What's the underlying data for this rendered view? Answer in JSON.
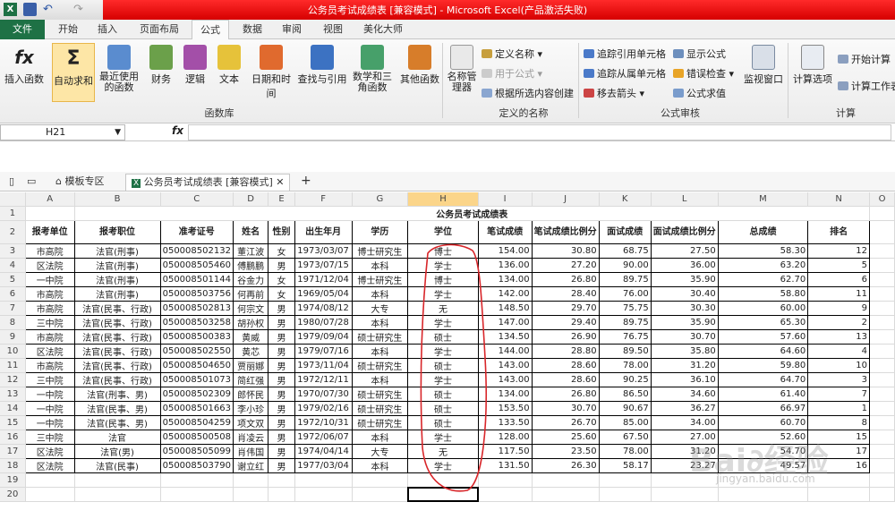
{
  "window_title": "公务员考试成绩表 [兼容模式] - Microsoft Excel(产品激活失败)",
  "quick_access": {
    "excel_icon": "X"
  },
  "tabs": [
    "文件",
    "开始",
    "插入",
    "页面布局",
    "公式",
    "数据",
    "审阅",
    "视图",
    "美化大师"
  ],
  "ribbon": {
    "insert_function": "插入函数",
    "autosum": "自动求和",
    "recent": "最近使用的函数",
    "finance": "财务",
    "logic": "逻辑",
    "text": "文本",
    "datetime": "日期和时间",
    "lookup": "查找与引用",
    "math": "数学和三角函数",
    "other": "其他函数",
    "group_library": "函数库",
    "name_manager": "名称管理器",
    "define_name": "定义名称",
    "use_in_formula": "用于公式",
    "create_from_sel": "根据所选内容创建",
    "group_names": "定义的名称",
    "trace_precedents": "追踪引用单元格",
    "trace_dependents": "追踪从属单元格",
    "remove_arrows": "移去箭头",
    "show_formulas": "显示公式",
    "error_check": "错误检查",
    "evaluate": "公式求值",
    "watch_window": "监视窗口",
    "group_audit": "公式审核",
    "calc_options": "计算选项",
    "calc_now": "开始计算",
    "calc_sheet": "计算工作表",
    "group_calc": "计算"
  },
  "formula_bar": {
    "cell": "H21",
    "fx": "fx"
  },
  "workbook_tabs": {
    "template": "模板专区",
    "file": "公务员考试成绩表 [兼容模式]",
    "add": "+"
  },
  "columns": [
    "A",
    "B",
    "C",
    "D",
    "E",
    "F",
    "G",
    "H",
    "I",
    "J",
    "K",
    "L",
    "M",
    "N",
    "O"
  ],
  "selected_column": "H",
  "sheet_title": "公务员考试成绩表",
  "headers": [
    "报考单位",
    "报考职位",
    "准考证号",
    "姓名",
    "性别",
    "出生年月",
    "学历",
    "学位",
    "笔试成绩",
    "笔试成绩比例分",
    "面试成绩",
    "面试成绩比例分",
    "总成绩",
    "排名"
  ],
  "rows": [
    [
      "市高院",
      "法官(刑事)",
      "050008502132",
      "董江波",
      "女",
      "1973/03/07",
      "博士研究生",
      "博士",
      "154.00",
      "30.80",
      "68.75",
      "27.50",
      "58.30",
      "12"
    ],
    [
      "区法院",
      "法官(刑事)",
      "050008505460",
      "傅鹏鹏",
      "男",
      "1973/07/15",
      "本科",
      "学士",
      "136.00",
      "27.20",
      "90.00",
      "36.00",
      "63.20",
      "5"
    ],
    [
      "一中院",
      "法官(刑事)",
      "050008501144",
      "谷金力",
      "女",
      "1971/12/04",
      "博士研究生",
      "博士",
      "134.00",
      "26.80",
      "89.75",
      "35.90",
      "62.70",
      "6"
    ],
    [
      "市高院",
      "法官(刑事)",
      "050008503756",
      "何再前",
      "女",
      "1969/05/04",
      "本科",
      "学士",
      "142.00",
      "28.40",
      "76.00",
      "30.40",
      "58.80",
      "11"
    ],
    [
      "市高院",
      "法官(民事、行政)",
      "050008502813",
      "何宗文",
      "男",
      "1974/08/12",
      "大专",
      "无",
      "148.50",
      "29.70",
      "75.75",
      "30.30",
      "60.00",
      "9"
    ],
    [
      "三中院",
      "法官(民事、行政)",
      "050008503258",
      "胡孙权",
      "男",
      "1980/07/28",
      "本科",
      "学士",
      "147.00",
      "29.40",
      "89.75",
      "35.90",
      "65.30",
      "2"
    ],
    [
      "市高院",
      "法官(民事、行政)",
      "050008500383",
      "黄威",
      "男",
      "1979/09/04",
      "硕士研究生",
      "硕士",
      "134.50",
      "26.90",
      "76.75",
      "30.70",
      "57.60",
      "13"
    ],
    [
      "区法院",
      "法官(民事、行政)",
      "050008502550",
      "黄芯",
      "男",
      "1979/07/16",
      "本科",
      "学士",
      "144.00",
      "28.80",
      "89.50",
      "35.80",
      "64.60",
      "4"
    ],
    [
      "市高院",
      "法官(民事、行政)",
      "050008504650",
      "贾丽娜",
      "男",
      "1973/11/04",
      "硕士研究生",
      "硕士",
      "143.00",
      "28.60",
      "78.00",
      "31.20",
      "59.80",
      "10"
    ],
    [
      "三中院",
      "法官(民事、行政)",
      "050008501073",
      "简红强",
      "男",
      "1972/12/11",
      "本科",
      "学士",
      "143.00",
      "28.60",
      "90.25",
      "36.10",
      "64.70",
      "3"
    ],
    [
      "一中院",
      "法官(刑事、男)",
      "050008502309",
      "郎怀民",
      "男",
      "1970/07/30",
      "硕士研究生",
      "硕士",
      "134.00",
      "26.80",
      "86.50",
      "34.60",
      "61.40",
      "7"
    ],
    [
      "一中院",
      "法官(民事、男)",
      "050008501663",
      "李小珍",
      "男",
      "1979/02/16",
      "硕士研究生",
      "硕士",
      "153.50",
      "30.70",
      "90.67",
      "36.27",
      "66.97",
      "1"
    ],
    [
      "一中院",
      "法官(民事、男)",
      "050008504259",
      "项文双",
      "男",
      "1972/10/31",
      "硕士研究生",
      "硕士",
      "133.50",
      "26.70",
      "85.00",
      "34.00",
      "60.70",
      "8"
    ],
    [
      "三中院",
      "法官",
      "050008500508",
      "肖凌云",
      "男",
      "1972/06/07",
      "本科",
      "学士",
      "128.00",
      "25.60",
      "67.50",
      "27.00",
      "52.60",
      "15"
    ],
    [
      "区法院",
      "法官(男)",
      "050008505099",
      "肖伟国",
      "男",
      "1974/04/14",
      "大专",
      "无",
      "117.50",
      "23.50",
      "78.00",
      "31.20",
      "54.70",
      "17"
    ],
    [
      "区法院",
      "法官(民事)",
      "050008503790",
      "谢立红",
      "男",
      "1977/03/04",
      "本科",
      "学士",
      "131.50",
      "26.30",
      "58.17",
      "23.27",
      "49.57",
      "16"
    ]
  ],
  "row_numbers": [
    "1",
    "2",
    "3",
    "4",
    "5",
    "6",
    "7",
    "8",
    "9",
    "10",
    "11",
    "12",
    "13",
    "14",
    "15",
    "16",
    "17",
    "18",
    "19",
    "20"
  ]
}
